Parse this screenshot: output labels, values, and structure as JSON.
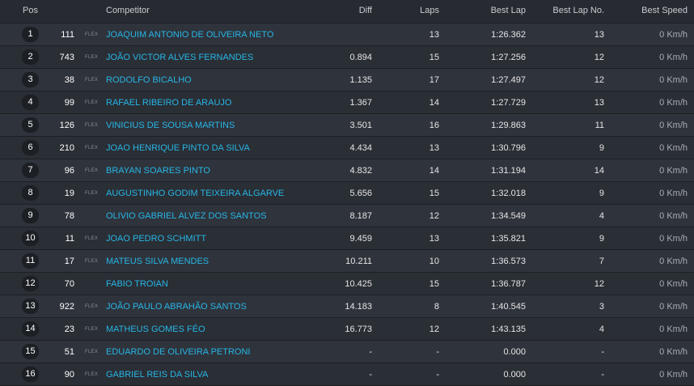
{
  "header": {
    "pos": "Pos",
    "competitor": "Competitor",
    "diff": "Diff",
    "laps": "Laps",
    "best_lap": "Best Lap",
    "best_lap_no": "Best Lap No.",
    "best_speed": "Best Speed"
  },
  "rows": [
    {
      "pos": "1",
      "num": "111",
      "flex": "FLEX",
      "name": "JOAQUIM ANTONIO DE OLIVEIRA NETO",
      "diff": "",
      "laps": "13",
      "best": "1:26.362",
      "bestno": "13",
      "speed": "0 Km/h"
    },
    {
      "pos": "2",
      "num": "743",
      "flex": "FLEX",
      "name": "JOÃO VICTOR ALVES FERNANDES",
      "diff": "0.894",
      "laps": "15",
      "best": "1:27.256",
      "bestno": "12",
      "speed": "0 Km/h"
    },
    {
      "pos": "3",
      "num": "38",
      "flex": "FLEX",
      "name": "RODOLFO BICALHO",
      "diff": "1.135",
      "laps": "17",
      "best": "1:27.497",
      "bestno": "12",
      "speed": "0 Km/h"
    },
    {
      "pos": "4",
      "num": "99",
      "flex": "FLEX",
      "name": "RAFAEL RIBEIRO DE ARAUJO",
      "diff": "1.367",
      "laps": "14",
      "best": "1:27.729",
      "bestno": "13",
      "speed": "0 Km/h"
    },
    {
      "pos": "5",
      "num": "126",
      "flex": "FLEX",
      "name": "VINICIUS DE SOUSA MARTINS",
      "diff": "3.501",
      "laps": "16",
      "best": "1:29.863",
      "bestno": "11",
      "speed": "0 Km/h"
    },
    {
      "pos": "6",
      "num": "210",
      "flex": "FLEX",
      "name": "JOAO HENRIQUE PINTO DA SILVA",
      "diff": "4.434",
      "laps": "13",
      "best": "1:30.796",
      "bestno": "9",
      "speed": "0 Km/h"
    },
    {
      "pos": "7",
      "num": "96",
      "flex": "FLEX",
      "name": "BRAYAN SOARES PINTO",
      "diff": "4.832",
      "laps": "14",
      "best": "1:31.194",
      "bestno": "14",
      "speed": "0 Km/h"
    },
    {
      "pos": "8",
      "num": "19",
      "flex": "FLEX",
      "name": "AUGUSTINHO GODIM TEIXEIRA ALGARVE",
      "diff": "5.656",
      "laps": "15",
      "best": "1:32.018",
      "bestno": "9",
      "speed": "0 Km/h"
    },
    {
      "pos": "9",
      "num": "78",
      "flex": "",
      "name": "OLIVIO GABRIEL ALVEZ DOS SANTOS",
      "diff": "8.187",
      "laps": "12",
      "best": "1:34.549",
      "bestno": "4",
      "speed": "0 Km/h"
    },
    {
      "pos": "10",
      "num": "11",
      "flex": "FLEX",
      "name": "JOAO PEDRO SCHMITT",
      "diff": "9.459",
      "laps": "13",
      "best": "1:35.821",
      "bestno": "9",
      "speed": "0 Km/h"
    },
    {
      "pos": "11",
      "num": "17",
      "flex": "FLEX",
      "name": "MATEUS SILVA MENDES",
      "diff": "10.211",
      "laps": "10",
      "best": "1:36.573",
      "bestno": "7",
      "speed": "0 Km/h"
    },
    {
      "pos": "12",
      "num": "70",
      "flex": "",
      "name": "FABIO TROIAN",
      "diff": "10.425",
      "laps": "15",
      "best": "1:36.787",
      "bestno": "12",
      "speed": "0 Km/h"
    },
    {
      "pos": "13",
      "num": "922",
      "flex": "FLEX",
      "name": "JOÃO PAULO ABRAHÃO SANTOS",
      "diff": "14.183",
      "laps": "8",
      "best": "1:40.545",
      "bestno": "3",
      "speed": "0 Km/h"
    },
    {
      "pos": "14",
      "num": "23",
      "flex": "FLEX",
      "name": "MATHEUS GOMES FÉO",
      "diff": "16.773",
      "laps": "12",
      "best": "1:43.135",
      "bestno": "4",
      "speed": "0 Km/h"
    },
    {
      "pos": "15",
      "num": "51",
      "flex": "FLEX",
      "name": "EDUARDO DE OLIVEIRA PETRONI",
      "diff": "-",
      "laps": "-",
      "best": "0.000",
      "bestno": "-",
      "speed": "0 Km/h"
    },
    {
      "pos": "16",
      "num": "90",
      "flex": "FLEX",
      "name": "GABRIEL REIS DA SILVA",
      "diff": "-",
      "laps": "-",
      "best": "0.000",
      "bestno": "-",
      "speed": "0 Km/h"
    }
  ]
}
